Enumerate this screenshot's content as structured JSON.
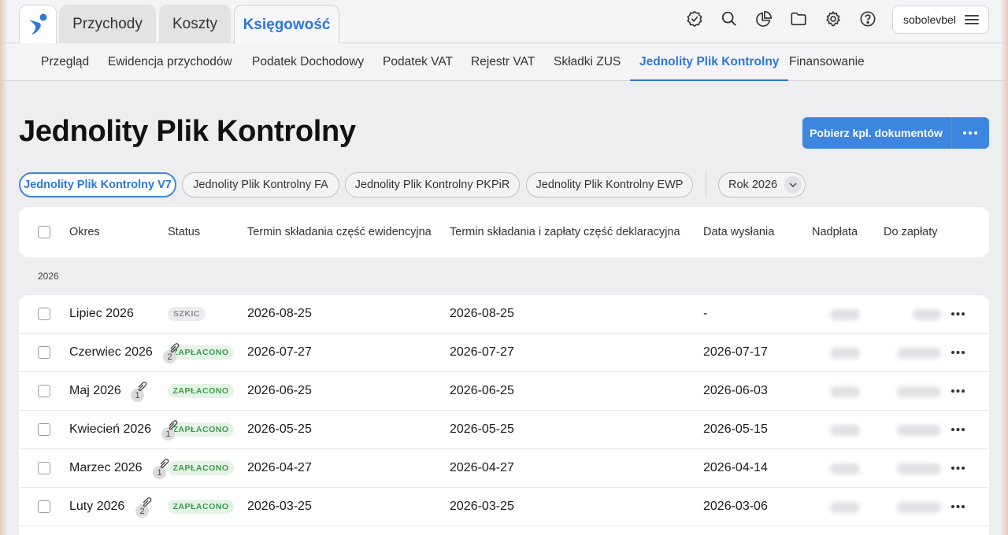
{
  "top_tabs": [
    {
      "label": "Przychody",
      "active": false
    },
    {
      "label": "Koszty",
      "active": false
    },
    {
      "label": "Księgowość",
      "active": true
    }
  ],
  "top_icons": [
    "verified-badge-icon",
    "search-icon",
    "pie-chart-icon",
    "folder-icon",
    "gear-icon",
    "help-icon"
  ],
  "user": {
    "name": "sobolevbel",
    "menu_icon": "hamburger-icon"
  },
  "sub_nav": [
    {
      "label": "Przegląd",
      "active": false
    },
    {
      "label": "Ewidencja przychodów",
      "active": false
    },
    {
      "label": "Podatek Dochodowy",
      "active": false
    },
    {
      "label": "Podatek VAT",
      "active": false
    },
    {
      "label": "Rejestr VAT",
      "active": false
    },
    {
      "label": "Składki ZUS",
      "active": false
    },
    {
      "label": "Jednolity Plik Kontrolny",
      "active": true
    },
    {
      "label": "Finansowanie",
      "active": false
    }
  ],
  "page": {
    "title": "Jednolity Plik Kontrolny",
    "download_button": "Pobierz kpl. dokumentów",
    "more_icon": "ellipsis-icon"
  },
  "filters": [
    {
      "label": "Jednolity Plik Kontrolny V7",
      "active": true
    },
    {
      "label": "Jednolity Plik Kontrolny FA",
      "active": false
    },
    {
      "label": "Jednolity Plik Kontrolny PKPiR",
      "active": false
    },
    {
      "label": "Jednolity Plik Kontrolny EWP",
      "active": false
    }
  ],
  "year_select": {
    "value": "Rok 2026",
    "icon": "chevron-down-icon"
  },
  "table": {
    "columns": [
      "Okres",
      "Status",
      "Termin składania część ewidencyjna",
      "Termin składania i zapłaty część deklaracyjna",
      "Data wysłania",
      "Nadpłata",
      "Do zapłaty"
    ],
    "group": "2026",
    "rows": [
      {
        "period": "Lipiec 2026",
        "status": "SZKIC",
        "status_type": "draft",
        "attachments": "",
        "deadline_evidence": "2026-08-25",
        "deadline_declaration": "2026-08-25",
        "sent": "-"
      },
      {
        "period": "Czerwiec 2026",
        "status": "ZAPŁACONO",
        "status_type": "paid",
        "attachments": "2",
        "deadline_evidence": "2026-07-27",
        "deadline_declaration": "2026-07-27",
        "sent": "2026-07-17"
      },
      {
        "period": "Maj 2026",
        "status": "ZAPŁACONO",
        "status_type": "paid",
        "attachments": "1",
        "deadline_evidence": "2026-06-25",
        "deadline_declaration": "2026-06-25",
        "sent": "2026-06-03"
      },
      {
        "period": "Kwiecień 2026",
        "status": "ZAPŁACONO",
        "status_type": "paid",
        "attachments": "1",
        "deadline_evidence": "2026-05-25",
        "deadline_declaration": "2026-05-25",
        "sent": "2026-05-15"
      },
      {
        "period": "Marzec 2026",
        "status": "ZAPŁACONO",
        "status_type": "paid",
        "attachments": "1",
        "deadline_evidence": "2026-04-27",
        "deadline_declaration": "2026-04-27",
        "sent": "2026-04-14"
      },
      {
        "period": "Luty 2026",
        "status": "ZAPŁACONO",
        "status_type": "paid",
        "attachments": "2",
        "deadline_evidence": "2026-03-25",
        "deadline_declaration": "2026-03-25",
        "sent": "2026-03-06"
      }
    ]
  },
  "colors": {
    "accent": "#3d86df",
    "paid_text": "#3f9a4c",
    "paid_bg": "#e4f3e6"
  }
}
